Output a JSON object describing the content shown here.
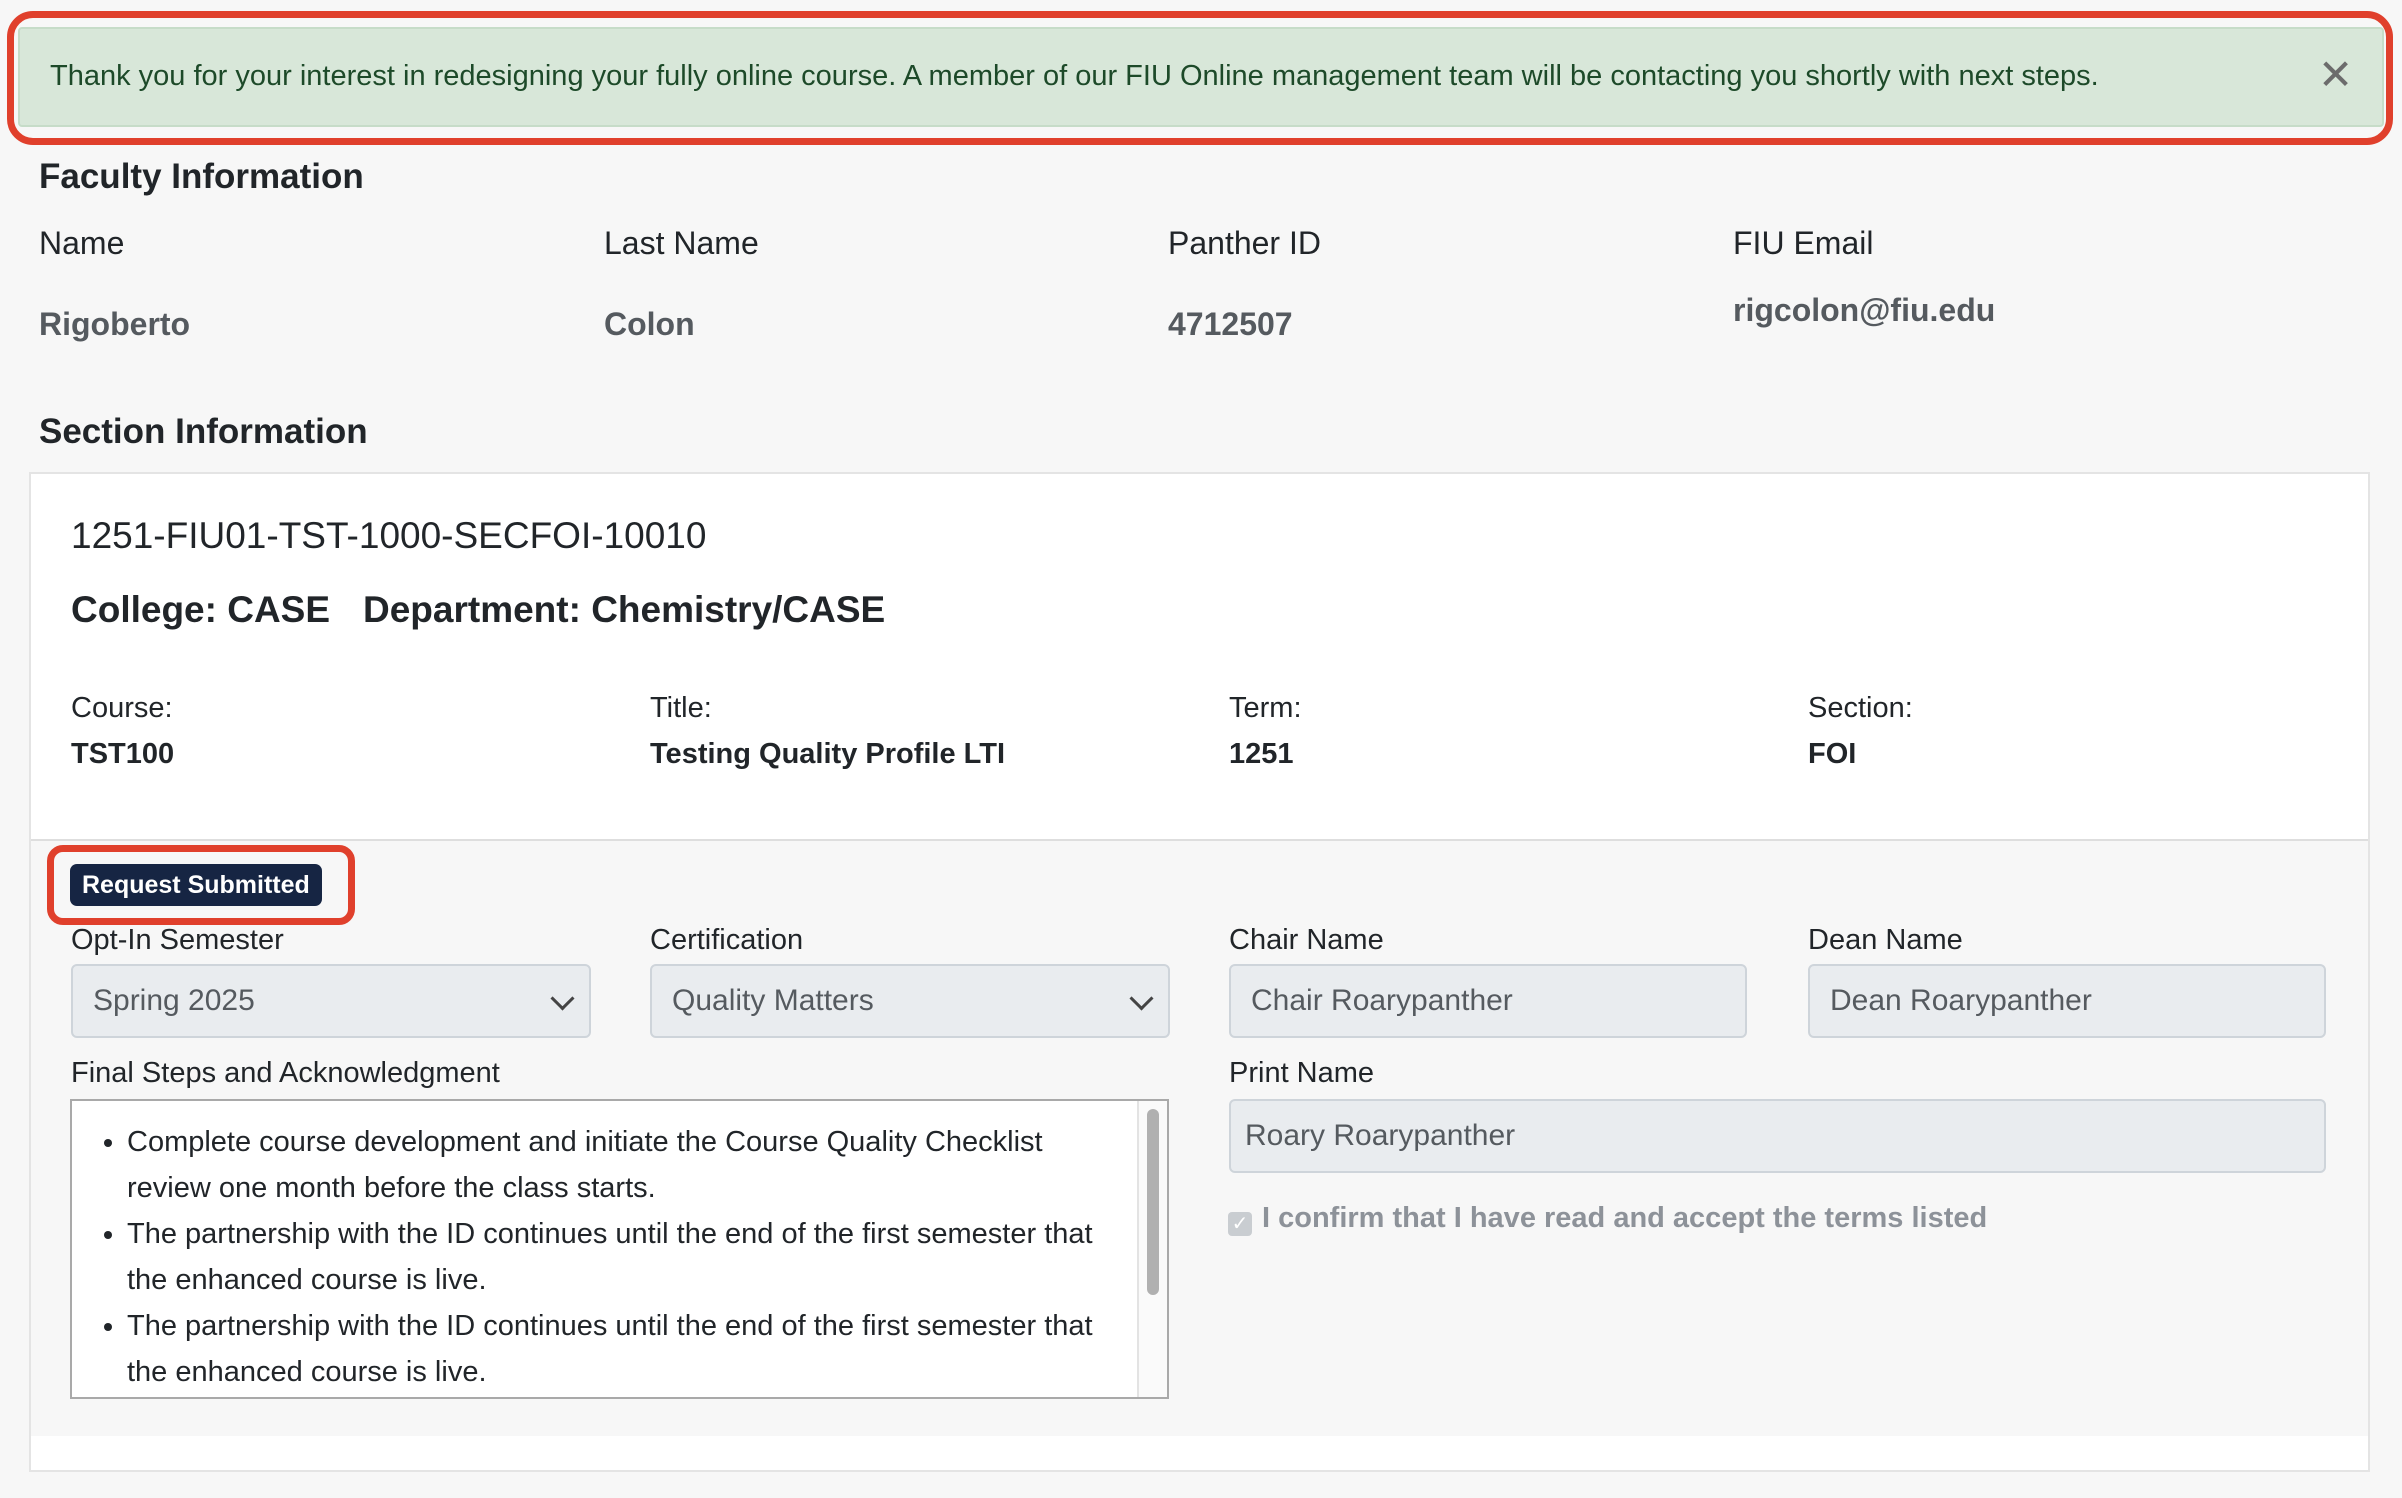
{
  "alert": {
    "message": "Thank you for your interest in redesigning your fully online course. A member of our FIU Online management team will be contacting you shortly with next steps.",
    "close_glyph": "✕",
    "color": "#d8e7d9"
  },
  "faculty": {
    "heading": "Faculty Information",
    "labels": {
      "name": "Name",
      "last_name": "Last Name",
      "panther_id": "Panther ID",
      "email": "FIU Email"
    },
    "values": {
      "name": "Rigoberto",
      "last_name": "Colon",
      "panther_id": "4712507",
      "email": "rigcolon@fiu.edu"
    }
  },
  "section": {
    "heading": "Section Information",
    "code": "1251-FIU01-TST-1000-SECFOI-10010",
    "college": "College: CASE",
    "department": "Department: Chemistry/CASE",
    "info": {
      "course_label": "Course:",
      "course": "TST100",
      "title_label": "Title:",
      "title": "Testing Quality Profile LTI",
      "term_label": "Term:",
      "term": "1251",
      "section_label": "Section:",
      "section": "FOI"
    }
  },
  "request": {
    "badge": "Request Submitted",
    "badge_color": "#162543",
    "opt_in_label": "Opt-In Semester",
    "opt_in_value": "Spring 2025",
    "certification_label": "Certification",
    "certification_value": "Quality Matters",
    "chair_label": "Chair Name",
    "chair_value": "Chair Roarypanther",
    "dean_label": "Dean Name",
    "dean_value": "Dean Roarypanther",
    "final_steps_label": "Final Steps and Acknowledgment",
    "final_steps": [
      "Complete course development and initiate the Course Quality Checklist review one month before the class starts.",
      "The partnership with the ID continues until the end of the first semester that the enhanced course is live.",
      "The partnership with the ID continues until the end of the first semester that the enhanced course is live."
    ],
    "print_name_label": "Print Name",
    "print_name_value": "Roary Roarypanther",
    "confirm_text": "I confirm that I have read and accept the terms listed",
    "confirm_checked": true
  }
}
